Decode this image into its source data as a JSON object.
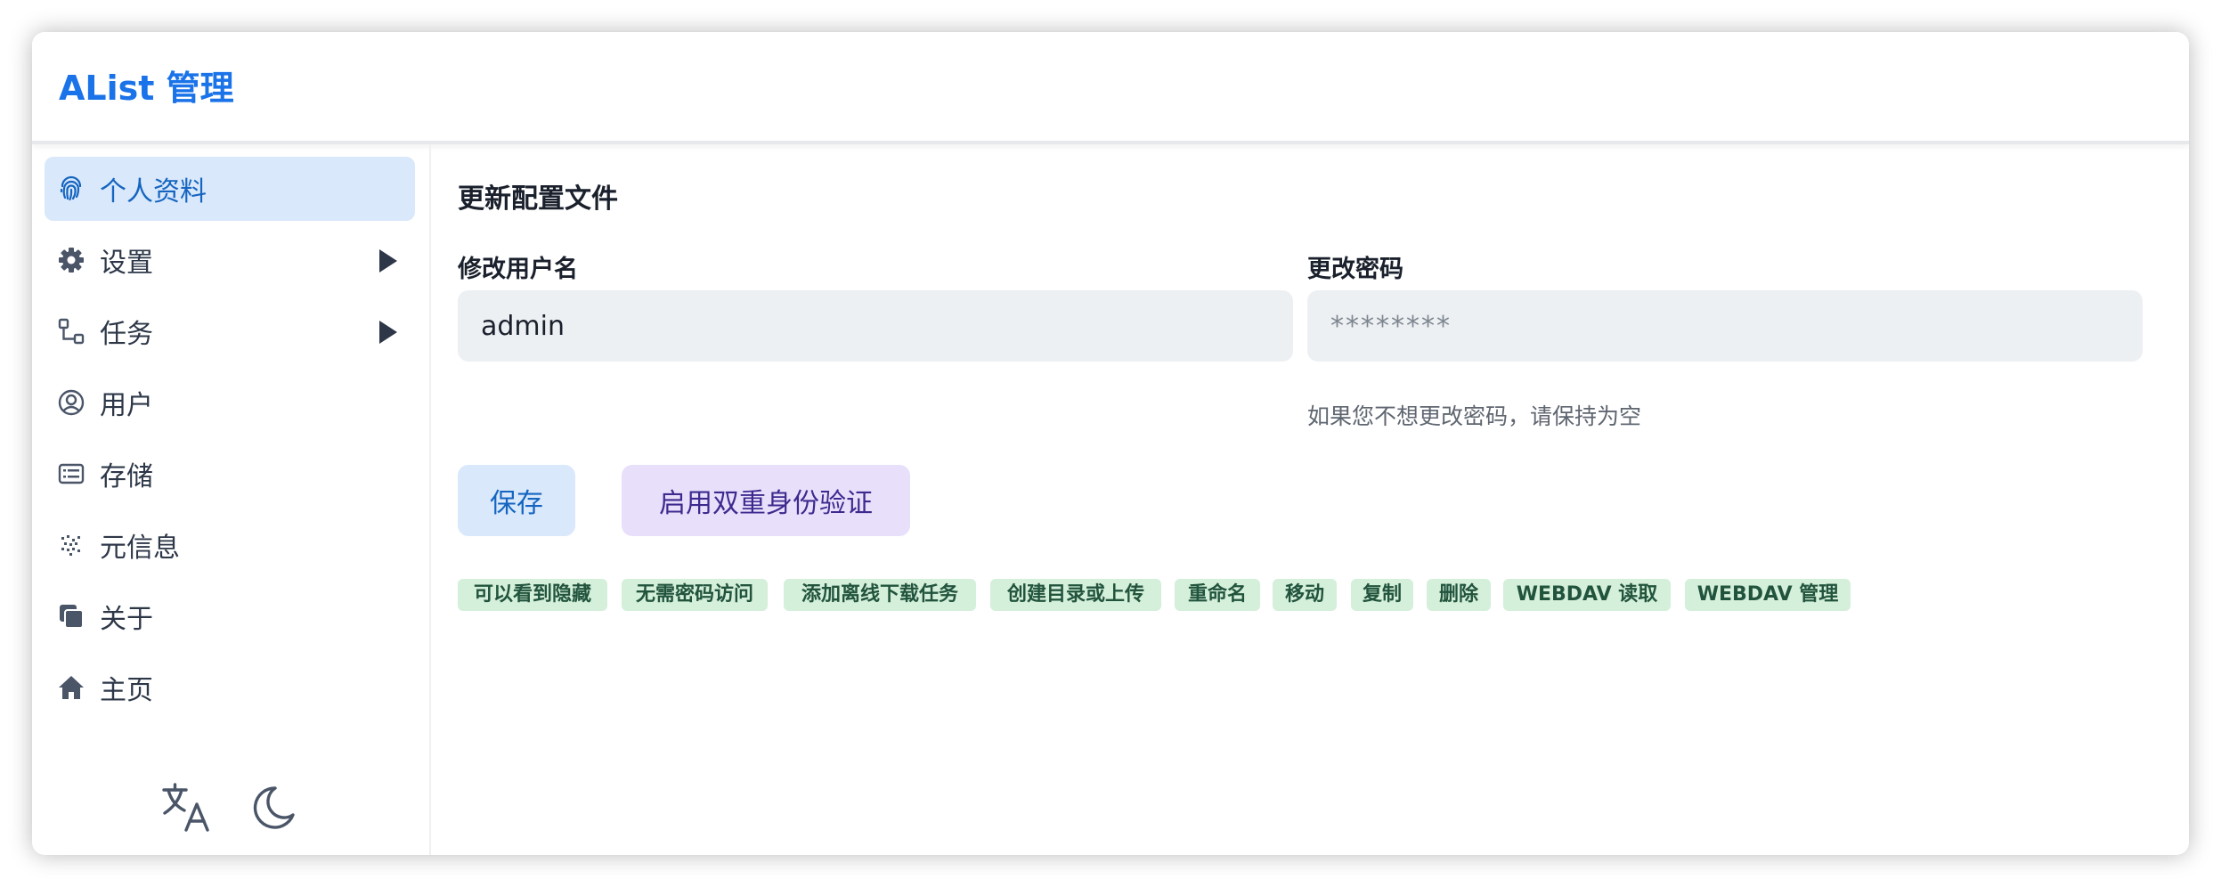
{
  "app": {
    "title": "AList 管理"
  },
  "sidebar": {
    "items": [
      {
        "label": "个人资料",
        "icon": "fingerprint-icon",
        "active": true
      },
      {
        "label": "设置",
        "icon": "gear-icon",
        "expandable": true
      },
      {
        "label": "任务",
        "icon": "workflow-icon",
        "expandable": true
      },
      {
        "label": "用户",
        "icon": "user-circle-icon"
      },
      {
        "label": "存储",
        "icon": "storage-icon"
      },
      {
        "label": "元信息",
        "icon": "metadata-icon"
      },
      {
        "label": "关于",
        "icon": "copy-icon"
      },
      {
        "label": "主页",
        "icon": "home-icon"
      }
    ],
    "bottom_icons": [
      "language-icon",
      "dark-mode-icon"
    ]
  },
  "main": {
    "section_title": "更新配置文件",
    "username": {
      "label": "修改用户名",
      "value": "admin"
    },
    "password": {
      "label": "更改密码",
      "placeholder": "********",
      "helper": "如果您不想更改密码，请保持为空"
    },
    "buttons": {
      "save": "保存",
      "enable_2fa": "启用双重身份验证"
    },
    "permissions": [
      "可以看到隐藏",
      "无需密码访问",
      "添加离线下载任务",
      "创建目录或上传",
      "重命名",
      "移动",
      "复制",
      "删除",
      "WEBDAV 读取",
      "WEBDAV 管理"
    ]
  },
  "colors": {
    "accent": "#1a73e8",
    "active_bg": "#d9e8fb",
    "input_bg": "#edf0f3",
    "twofa_bg": "#e8e0fb",
    "tag_bg": "#d4efda",
    "tag_text": "#22543d"
  }
}
